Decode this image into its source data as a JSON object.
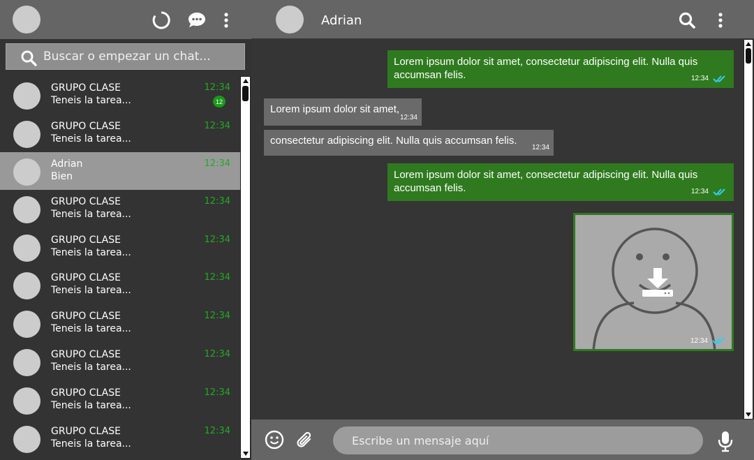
{
  "sidebar": {
    "search_placeholder": "Buscar o empezar un chat...",
    "chats": [
      {
        "name": "GRUPO CLASE",
        "preview": "Teneis la tarea...",
        "time": "12:34",
        "unread": "12",
        "active": false
      },
      {
        "name": "GRUPO CLASE",
        "preview": "Teneis la tarea...",
        "time": "12:34",
        "unread": "",
        "active": false
      },
      {
        "name": "Adrian",
        "preview": "Bien",
        "time": "12:34",
        "unread": "",
        "active": true
      },
      {
        "name": "GRUPO CLASE",
        "preview": "Teneis la tarea...",
        "time": "12:34",
        "unread": "",
        "active": false
      },
      {
        "name": "GRUPO CLASE",
        "preview": "Teneis la tarea...",
        "time": "12:34",
        "unread": "",
        "active": false
      },
      {
        "name": "GRUPO CLASE",
        "preview": "Teneis la tarea...",
        "time": "12:34",
        "unread": "",
        "active": false
      },
      {
        "name": "GRUPO CLASE",
        "preview": "Teneis la tarea...",
        "time": "12:34",
        "unread": "",
        "active": false
      },
      {
        "name": "GRUPO CLASE",
        "preview": "Teneis la tarea...",
        "time": "12:34",
        "unread": "",
        "active": false
      },
      {
        "name": "GRUPO CLASE",
        "preview": "Teneis la tarea...",
        "time": "12:34",
        "unread": "",
        "active": false
      },
      {
        "name": "GRUPO CLASE",
        "preview": "Teneis la tarea...",
        "time": "12:34",
        "unread": "",
        "active": false
      }
    ]
  },
  "conversation": {
    "contact_name": "Adrian",
    "messages": [
      {
        "direction": "out",
        "text": "Lorem ipsum dolor sit amet, consectetur adipiscing elit. Nulla quis accumsan felis.",
        "time": "12:34"
      },
      {
        "direction": "in",
        "text": "Lorem ipsum dolor sit amet,",
        "time": "12:34"
      },
      {
        "direction": "in",
        "text": "consectetur adipiscing elit. Nulla quis accumsan felis.",
        "time": "12:34"
      },
      {
        "direction": "out",
        "text": "Lorem ipsum dolor sit amet, consectetur adipiscing elit. Nulla quis accumsan felis.",
        "time": "12:34"
      }
    ],
    "image_message": {
      "time": "12:34",
      "icon": "download-icon"
    }
  },
  "composer": {
    "placeholder": "Escribe un mensaje aquí"
  },
  "colors": {
    "header": "#656565",
    "background": "#333333",
    "outgoing": "#2f7a1f",
    "incoming": "#6a6a6a",
    "time_green": "#22aa22",
    "read_ticks": "#33ccee"
  }
}
